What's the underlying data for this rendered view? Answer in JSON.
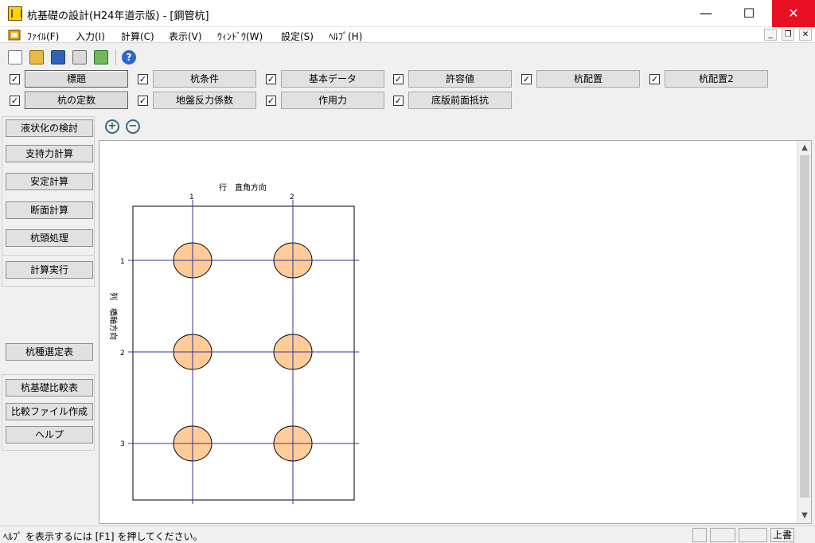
{
  "window": {
    "title": "杭基礎の設計(H24年道示版) - [鋼管杭]",
    "minimize": "—",
    "maximize": "☐",
    "close": "✕"
  },
  "menu": {
    "items": [
      "ﾌｧｲﾙ(F)",
      "入力(I)",
      "計算(C)",
      "表示(V)",
      "ｳｨﾝﾄﾞｳ(W)",
      "設定(S)",
      "ﾍﾙﾌﾟ(H)"
    ],
    "mdi_min": "_",
    "mdi_restore": "❐",
    "mdi_close": "✕"
  },
  "toolbar": {
    "icons": [
      "new-icon",
      "open-icon",
      "save-icon",
      "print-icon",
      "edit-icon",
      "help-icon"
    ],
    "help_glyph": "?"
  },
  "panel_rows": {
    "row1": [
      {
        "label": "標題"
      },
      {
        "label": "杭条件"
      },
      {
        "label": "基本データ"
      },
      {
        "label": "許容値"
      },
      {
        "label": "杭配置"
      },
      {
        "label": "杭配置2"
      }
    ],
    "row2": [
      {
        "label": "杭の定数"
      },
      {
        "label": "地盤反力係数"
      },
      {
        "label": "作用力"
      },
      {
        "label": "底版前面抵抗"
      }
    ],
    "check": "✓"
  },
  "left_buttons": {
    "b1": "液状化の検討",
    "b2": "支持力計算",
    "b3": "安定計算",
    "b4": "断面計算",
    "b5": "杭頭処理",
    "b6": "計算実行",
    "b7": "杭種選定表",
    "b8": "杭基礎比較表",
    "b9": "比較ファイル作成",
    "b10": "ヘルプ"
  },
  "zoom": {
    "in": "+",
    "out": "−"
  },
  "drawing": {
    "row_axis_label": "行　直角方向",
    "col_axis_label": "列　橋軸方向",
    "row_numbers": [
      "1",
      "2"
    ],
    "col_numbers": [
      "1",
      "2",
      "3"
    ],
    "pile_color": "#FFCC99",
    "grid_color": "#333399",
    "piles": [
      {
        "row": 1,
        "col": 1
      },
      {
        "row": 2,
        "col": 1
      },
      {
        "row": 1,
        "col": 2
      },
      {
        "row": 2,
        "col": 2
      },
      {
        "row": 1,
        "col": 3
      },
      {
        "row": 2,
        "col": 3
      }
    ]
  },
  "scroll": {
    "up": "▲",
    "down": "▼"
  },
  "status": {
    "help_text": "ﾍﾙﾌﾟ を表示するには [F1] を押してください。",
    "mode": "上書"
  }
}
